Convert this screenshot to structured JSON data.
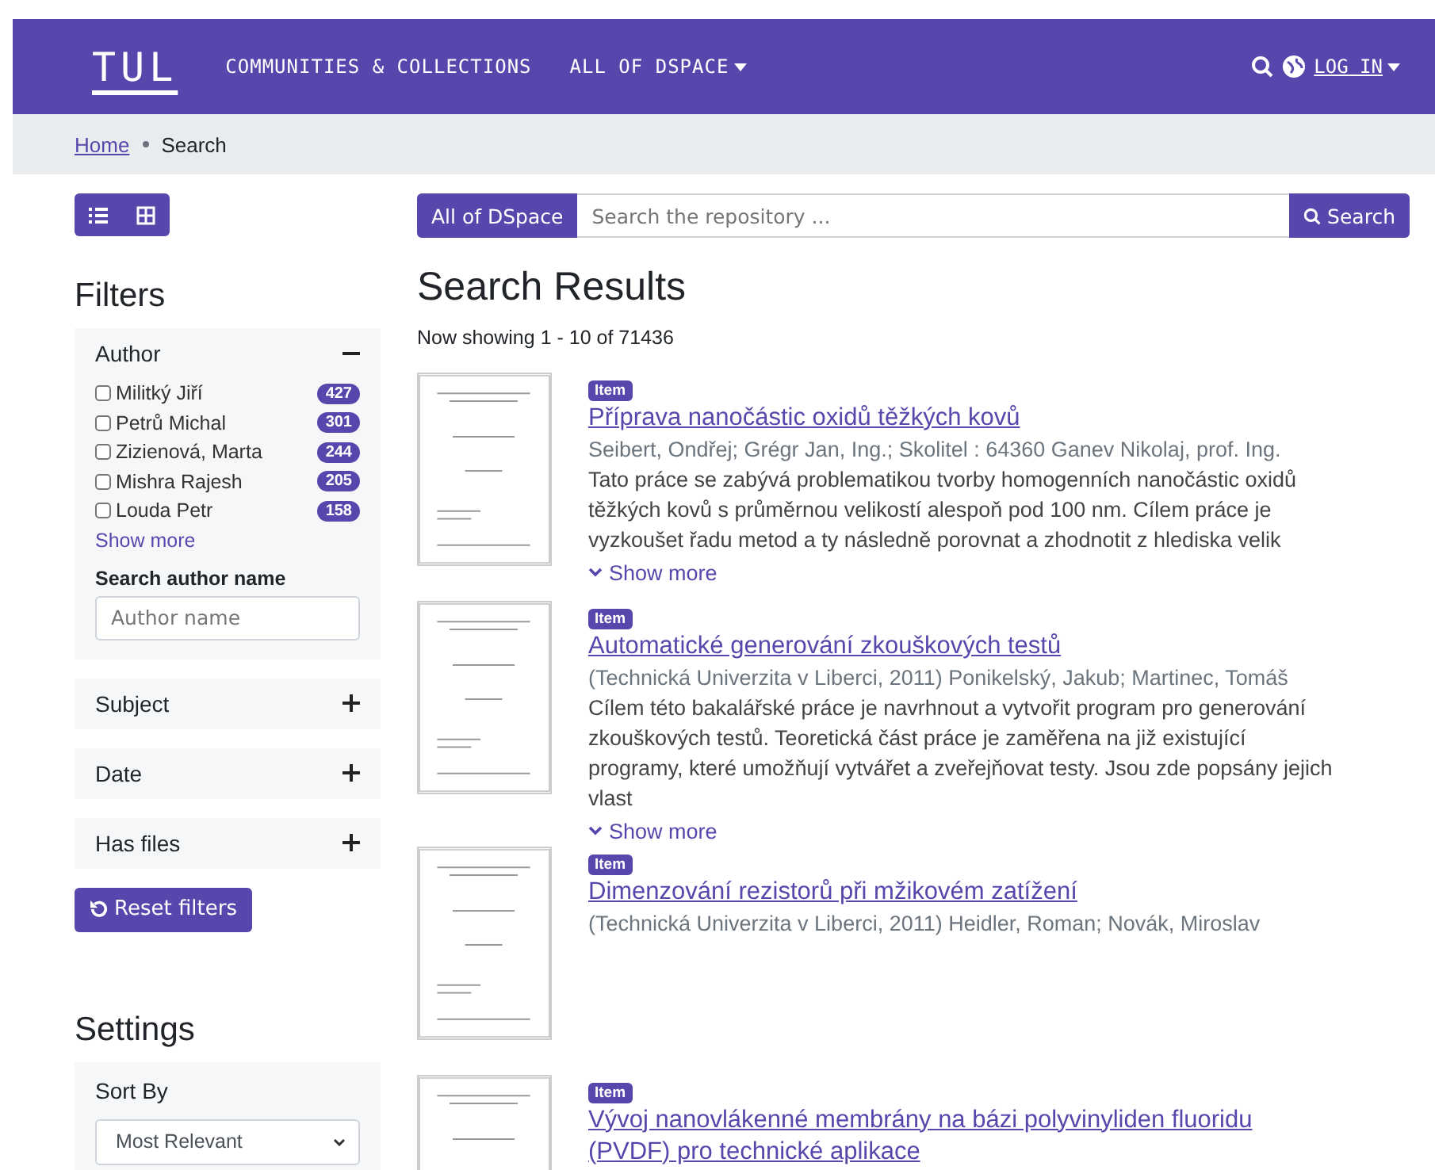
{
  "header": {
    "logo": "TUL",
    "nav": [
      {
        "label": "COMMUNITIES & COLLECTIONS",
        "dropdown": false
      },
      {
        "label": "ALL OF DSPACE",
        "dropdown": true
      }
    ],
    "login": "LOG IN"
  },
  "breadcrumb": [
    {
      "label": "Home",
      "link": true
    },
    {
      "label": "Search",
      "link": false
    }
  ],
  "search": {
    "scope": "All of DSpace",
    "placeholder": "Search the repository ...",
    "button": "Search"
  },
  "filters": {
    "title": "Filters",
    "groups": [
      {
        "label": "Author",
        "expanded": true,
        "options": [
          {
            "label": "Militký Jiří",
            "count": "427",
            "checked": false
          },
          {
            "label": "Petrů Michal",
            "count": "301",
            "checked": false
          },
          {
            "label": "Zizienová, Marta",
            "count": "244",
            "checked": false
          },
          {
            "label": "Mishra Rajesh",
            "count": "205",
            "checked": false
          },
          {
            "label": "Louda Petr",
            "count": "158",
            "checked": false
          }
        ],
        "show_more": "Show more",
        "search_label": "Search author name",
        "search_placeholder": "Author name"
      },
      {
        "label": "Subject",
        "expanded": false
      },
      {
        "label": "Date",
        "expanded": false
      },
      {
        "label": "Has files",
        "expanded": false
      }
    ],
    "reset": "Reset filters"
  },
  "settings": {
    "title": "Settings",
    "sort_label": "Sort By",
    "sort_value": "Most Relevant"
  },
  "results": {
    "title": "Search Results",
    "summary": "Now showing 1 - 10 of 71436",
    "items": [
      {
        "type": "Item",
        "title": "Příprava nanočástic oxidů těžkých kovů",
        "meta": "Seibert, Ondřej; Grégr Jan, Ing.; Skolitel : 64360 Ganev Nikolaj, prof. Ing.",
        "abstract": "Tato práce se zabývá problematikou tvorby homogenních nanočástic oxidů těžkých kovů s průměrnou velikostí alespoň pod 100 nm. Cílem práce je vyzkoušet řadu metod a ty následně porovnat a zhodnotit z hlediska velik",
        "show_more": "Show more"
      },
      {
        "type": "Item",
        "title": "Automatické generování zkouškových testů",
        "meta": "(Technická Univerzita v Liberci, 2011) Ponikelský, Jakub; Martinec, Tomáš",
        "abstract": "Cílem této bakalářské práce je navrhnout a vytvořit program pro generování zkouškových testů. Teoretická část práce je zaměřena na již existující programy, které umožňují vytvářet a zveřejňovat testy. Jsou zde popsány jejich vlast",
        "show_more": "Show more"
      },
      {
        "type": "Item",
        "title": "Dimenzování rezistorů při mžikovém zatížení",
        "meta": "(Technická Univerzita v Liberci, 2011) Heidler, Roman; Novák, Miroslav"
      },
      {
        "type": "Item",
        "title": "Vývoj nanovlákenné membrány na bázi polyvinyliden fluoridu (PVDF) pro technické aplikace"
      }
    ]
  }
}
